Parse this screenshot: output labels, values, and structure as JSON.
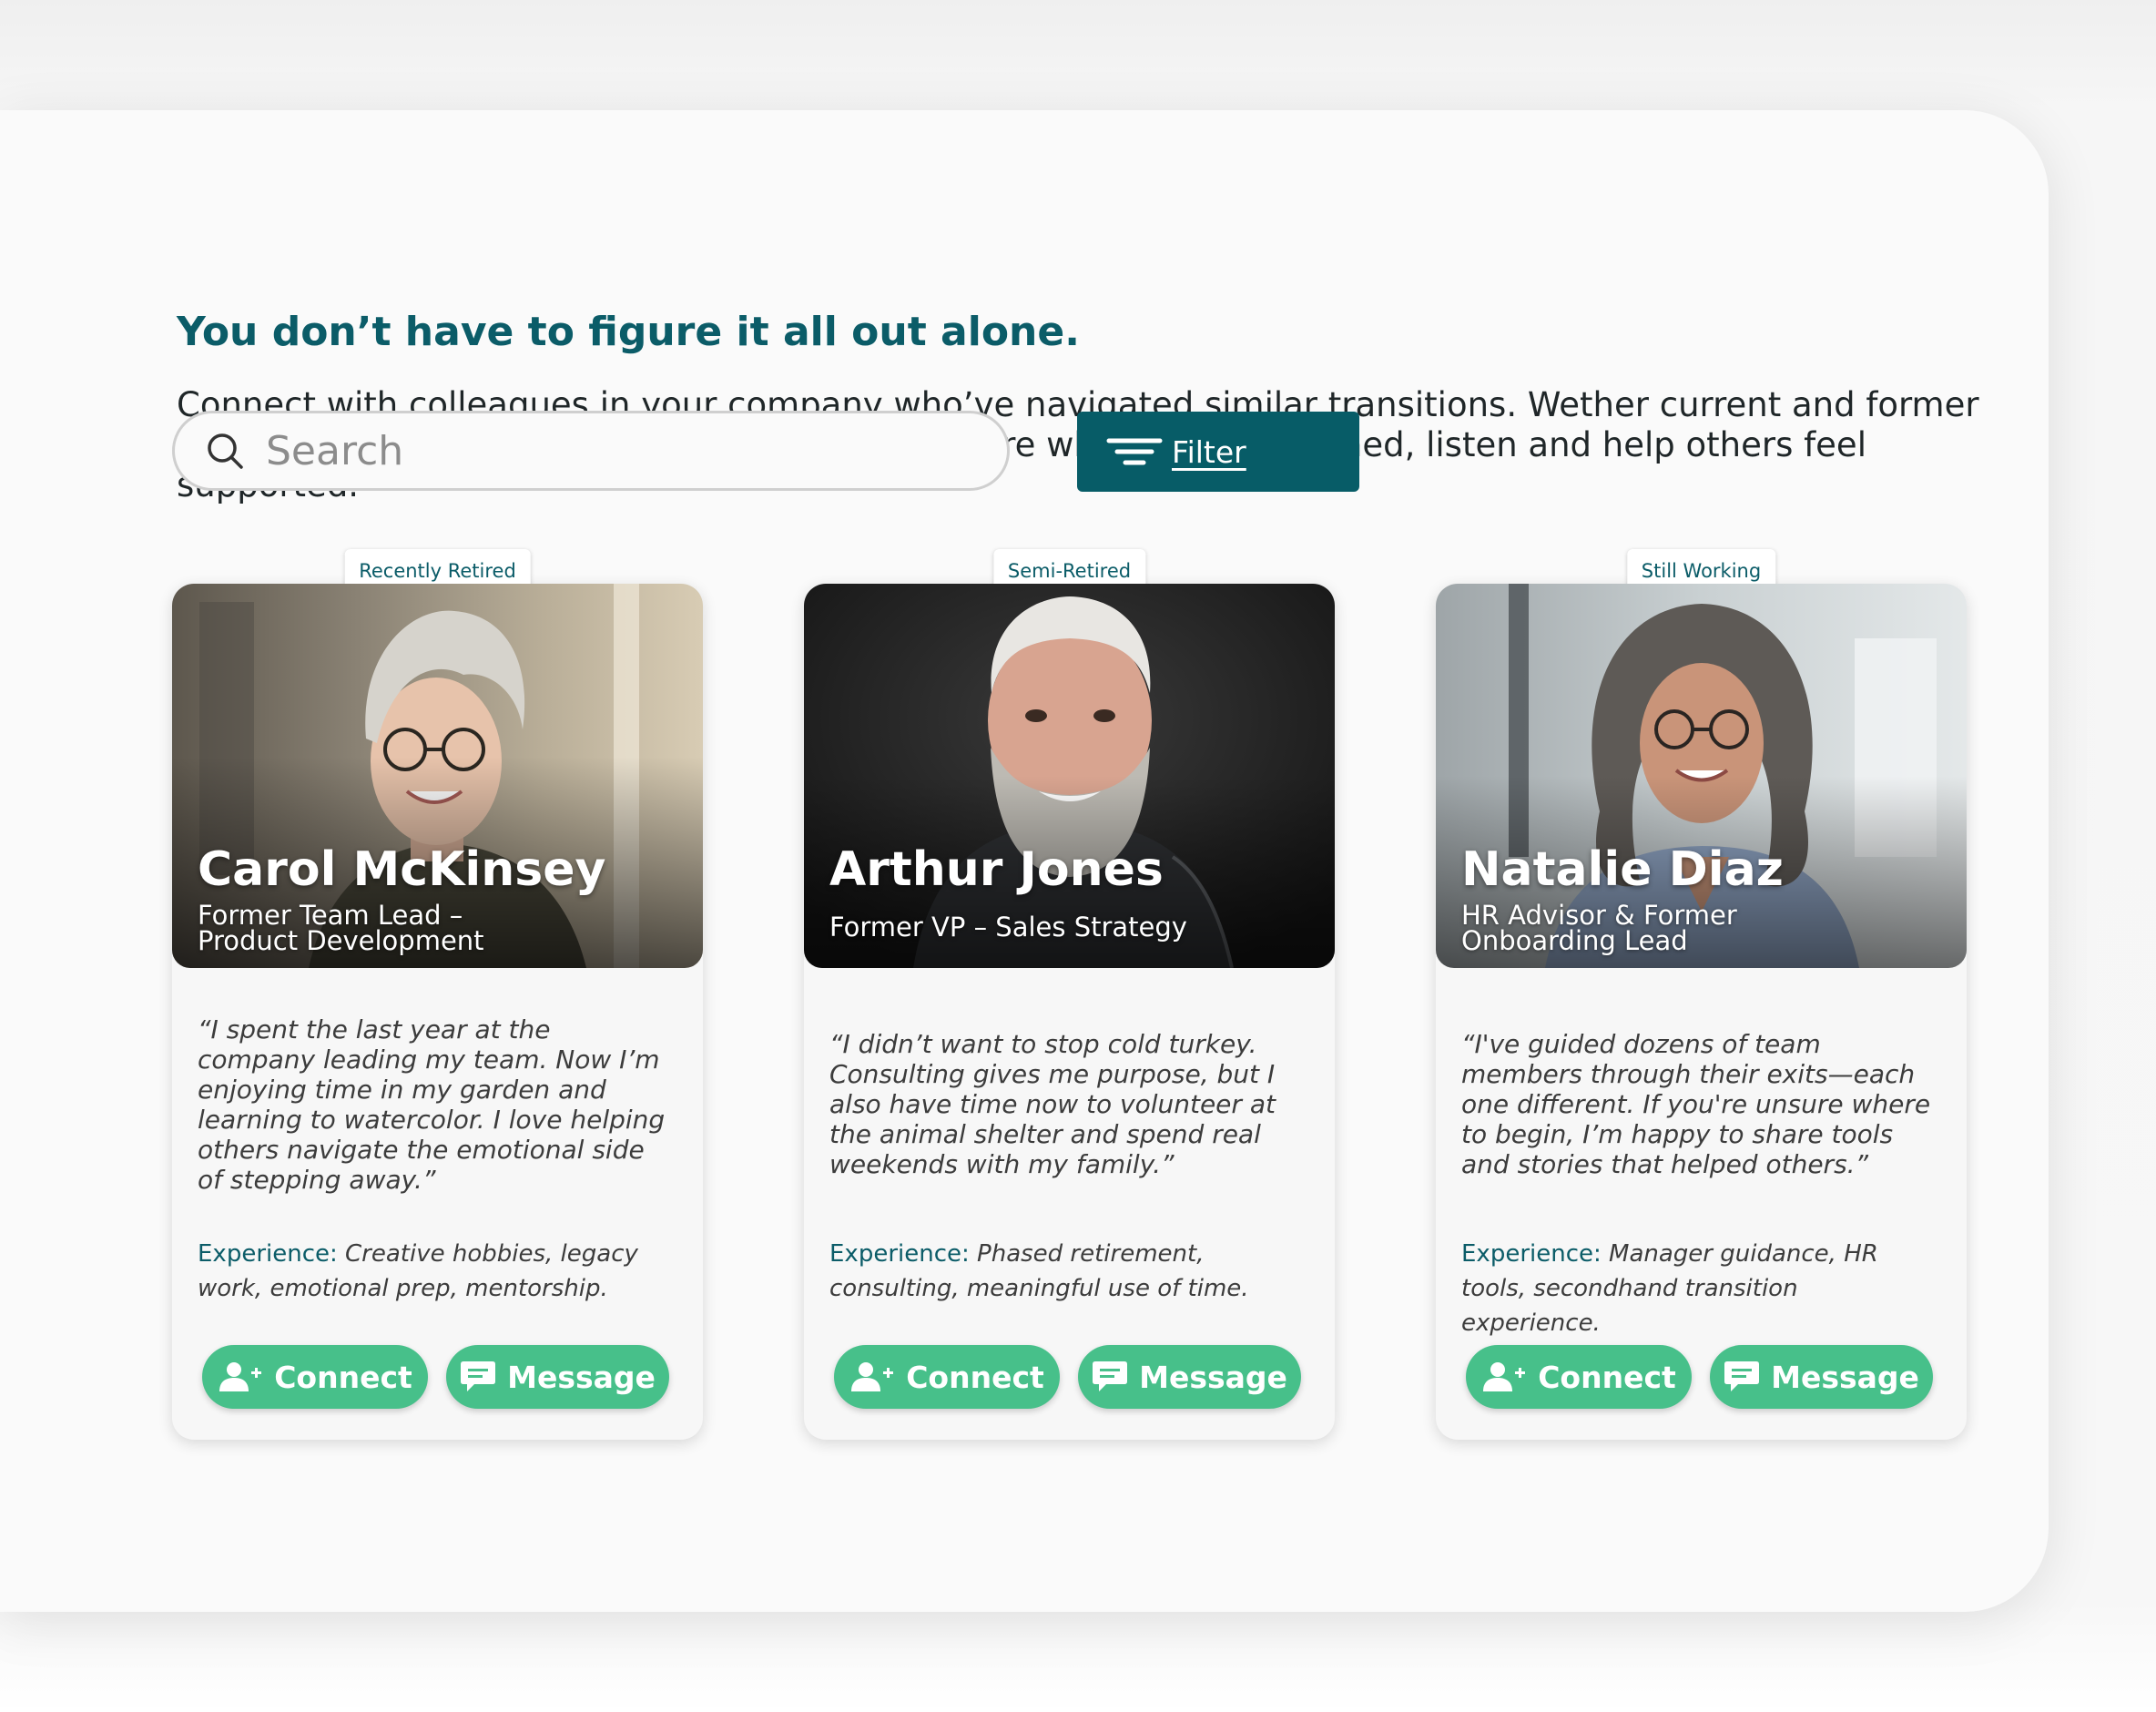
{
  "header": {
    "title": "You don’t have to figure it all out alone.",
    "intro": "Connect with colleagues in your company who’ve navigated similar transitions. Wether current and former employees, these peers have volunteered to share what they’ve learned, listen and help others feel supported."
  },
  "search": {
    "placeholder": "Search"
  },
  "filter": {
    "label": "Filter"
  },
  "colors": {
    "accent": "#0b5c68",
    "button": "#47c08a",
    "filter": "#075c67"
  },
  "cards": [
    {
      "tag": "Recently Retired",
      "name": "Carol McKinsey",
      "role": "Former Team Lead – Product Development",
      "quote": "“I spent the last year at the company leading my team. Now I’m enjoying time in my garden and learning to watercolor. I love helping others navigate the emotional side of stepping away.”",
      "experience_label": "Experience:",
      "experience": "Creative hobbies, legacy work, emotional prep, mentorship.",
      "connect_label": "Connect",
      "message_label": "Message"
    },
    {
      "tag": "Semi-Retired",
      "name": "Arthur Jones",
      "role": "Former VP – Sales Strategy",
      "quote": "“I didn’t want to stop cold turkey. Consulting gives me purpose, but I also have time now to volunteer at the animal shelter and spend real weekends with my family.”",
      "experience_label": "Experience:",
      "experience": "Phased retirement, consulting, meaningful use of time.",
      "connect_label": "Connect",
      "message_label": "Message"
    },
    {
      "tag": "Still Working",
      "name": "Natalie Diaz",
      "role": "HR Advisor & Former Onboarding Lead",
      "quote": "“I've guided dozens of team members through their exits—each one different. If you're unsure where to begin, I’m happy to share tools and stories that helped others.”",
      "experience_label": "Experience:",
      "experience": "Manager guidance, HR tools, secondhand transition experience.",
      "connect_label": "Connect",
      "message_label": "Message"
    }
  ]
}
